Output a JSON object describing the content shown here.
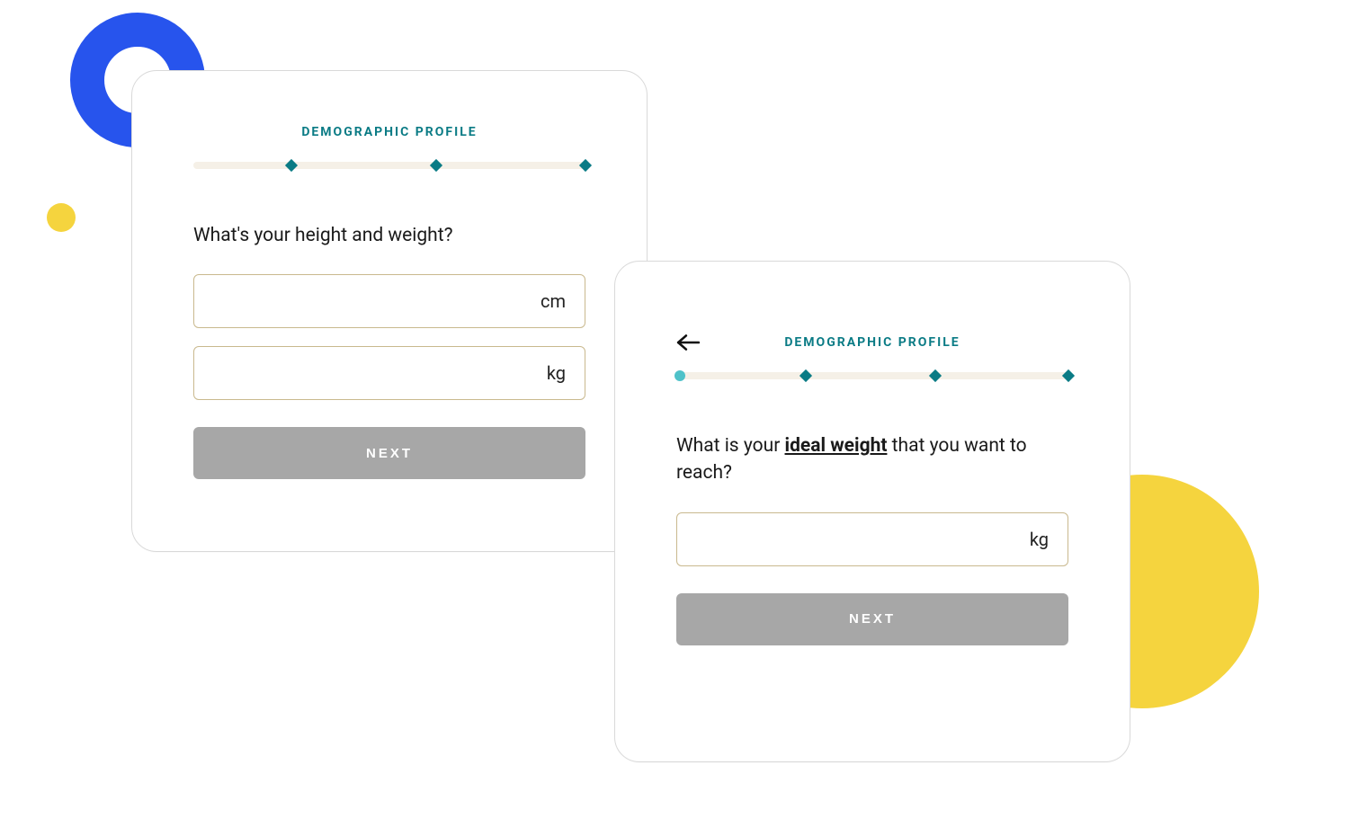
{
  "decor": {
    "ring_color": "#2754ed",
    "small_dot_color": "#f5d43e",
    "half_circle_color": "#f5d43e"
  },
  "card1": {
    "step_title": "DEMOGRAPHIC PROFILE",
    "question": "What's your height and weight?",
    "height_unit": "cm",
    "weight_unit": "kg",
    "height_value": "",
    "weight_value": "",
    "next_label": "NEXT"
  },
  "card2": {
    "step_title": "DEMOGRAPHIC PROFILE",
    "question_prefix": "What is your ",
    "question_emph": "ideal weight",
    "question_suffix": " that you want to reach?",
    "weight_unit": "kg",
    "weight_value": "",
    "next_label": "NEXT"
  }
}
